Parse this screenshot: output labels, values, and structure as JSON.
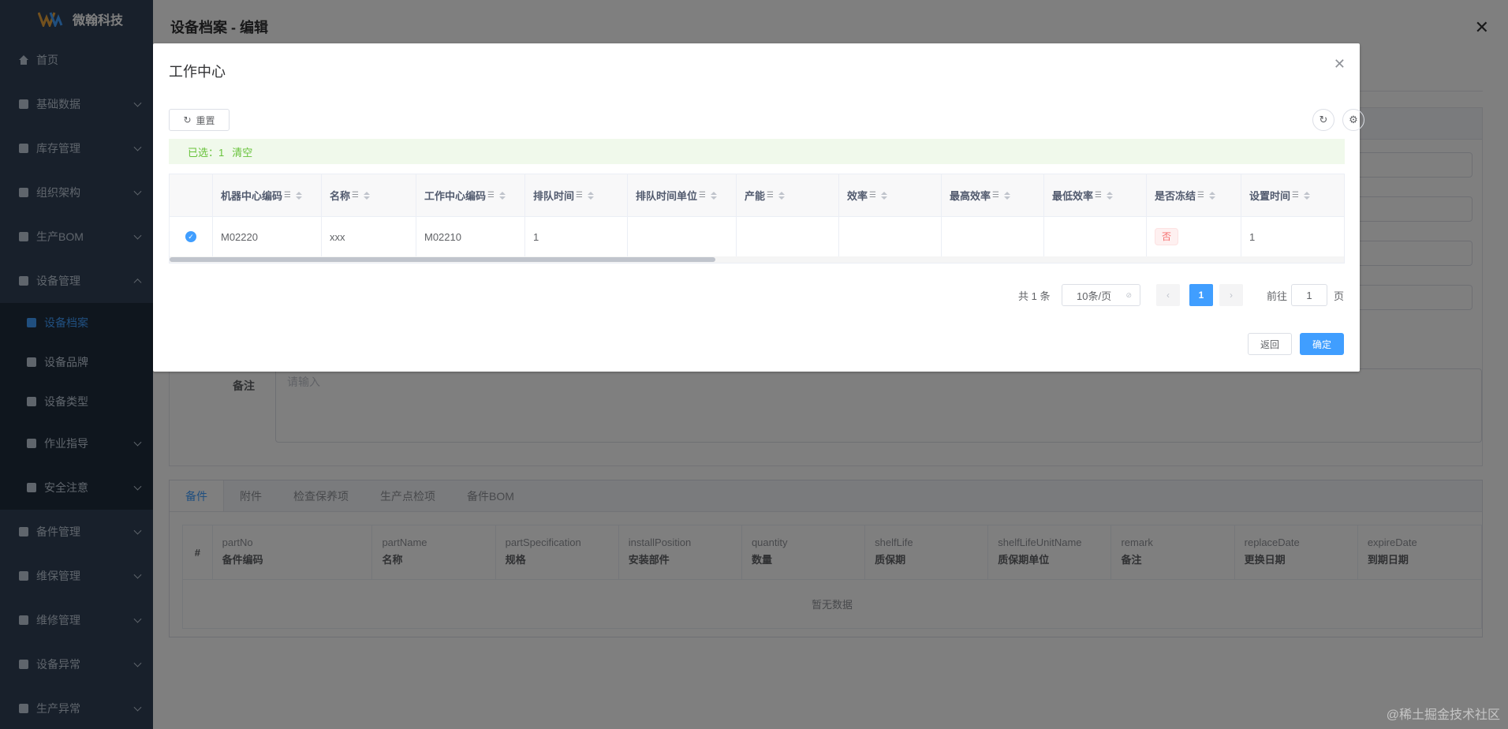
{
  "app": {
    "logo_text": "微翰科技"
  },
  "sidebar": {
    "items": [
      {
        "label": "首页",
        "icon": "home-icon"
      },
      {
        "label": "基础数据",
        "icon": "grid-icon"
      },
      {
        "label": "库存管理",
        "icon": "inventory-icon"
      },
      {
        "label": "组织架构",
        "icon": "org-icon"
      },
      {
        "label": "生产BOM",
        "icon": "bom-icon"
      },
      {
        "label": "设备管理",
        "icon": "equipment-icon"
      }
    ],
    "sub_items": [
      {
        "label": "设备档案",
        "icon": "archive-icon"
      },
      {
        "label": "设备品牌",
        "icon": "tag-icon"
      },
      {
        "label": "设备类型",
        "icon": "list-icon"
      },
      {
        "label": "作业指导",
        "icon": "doc-icon"
      },
      {
        "label": "安全注意",
        "icon": "safety-icon"
      }
    ],
    "bottom_items": [
      {
        "label": "备件管理",
        "icon": "spare-icon"
      },
      {
        "label": "维保管理",
        "icon": "maintain-icon"
      },
      {
        "label": "维修管理",
        "icon": "repair-icon"
      },
      {
        "label": "设备异常",
        "icon": "bug-icon"
      },
      {
        "label": "生产异常",
        "icon": "alert-icon"
      }
    ]
  },
  "page": {
    "title": "设备档案 - 编辑",
    "remark_label": "备注",
    "remark_placeholder": "请输入",
    "tabs": [
      "备件",
      "附件",
      "检查保养项",
      "生产点检项",
      "备件BOM"
    ],
    "bottom_table": {
      "index_header": "#",
      "columns": [
        {
          "field": "partNo",
          "label": "备件编码"
        },
        {
          "field": "partName",
          "label": "名称"
        },
        {
          "field": "partSpecification",
          "label": "规格"
        },
        {
          "field": "installPosition",
          "label": "安装部件"
        },
        {
          "field": "quantity",
          "label": "数量"
        },
        {
          "field": "shelfLife",
          "label": "质保期"
        },
        {
          "field": "shelfLifeUnitName",
          "label": "质保期单位"
        },
        {
          "field": "remark",
          "label": "备注"
        },
        {
          "field": "replaceDate",
          "label": "更换日期"
        },
        {
          "field": "expireDate",
          "label": "到期日期"
        }
      ],
      "empty_text": "暂无数据"
    }
  },
  "dialog": {
    "title": "工作中心",
    "reset_label": "重置",
    "selected_text": "已选：1",
    "clear_label": "清空",
    "columns": [
      "机器中心编码",
      "名称",
      "工作中心编码",
      "排队时间",
      "排队时间单位",
      "产能",
      "效率",
      "最高效率",
      "最低效率",
      "是否冻结",
      "设置时间"
    ],
    "rows": [
      {
        "checked": true,
        "cells": [
          "M02220",
          "xxx",
          "M02210",
          "1",
          "",
          "",
          "",
          "",
          "",
          "否",
          "1"
        ]
      }
    ],
    "pagination": {
      "total_text": "共 1 条",
      "page_size": "10条/页",
      "current_page": "1",
      "goto_label": "前往",
      "goto_value": "1",
      "page_unit": "页"
    },
    "back_label": "返回",
    "confirm_label": "确定"
  },
  "watermark": "@稀土掘金技术社区"
}
